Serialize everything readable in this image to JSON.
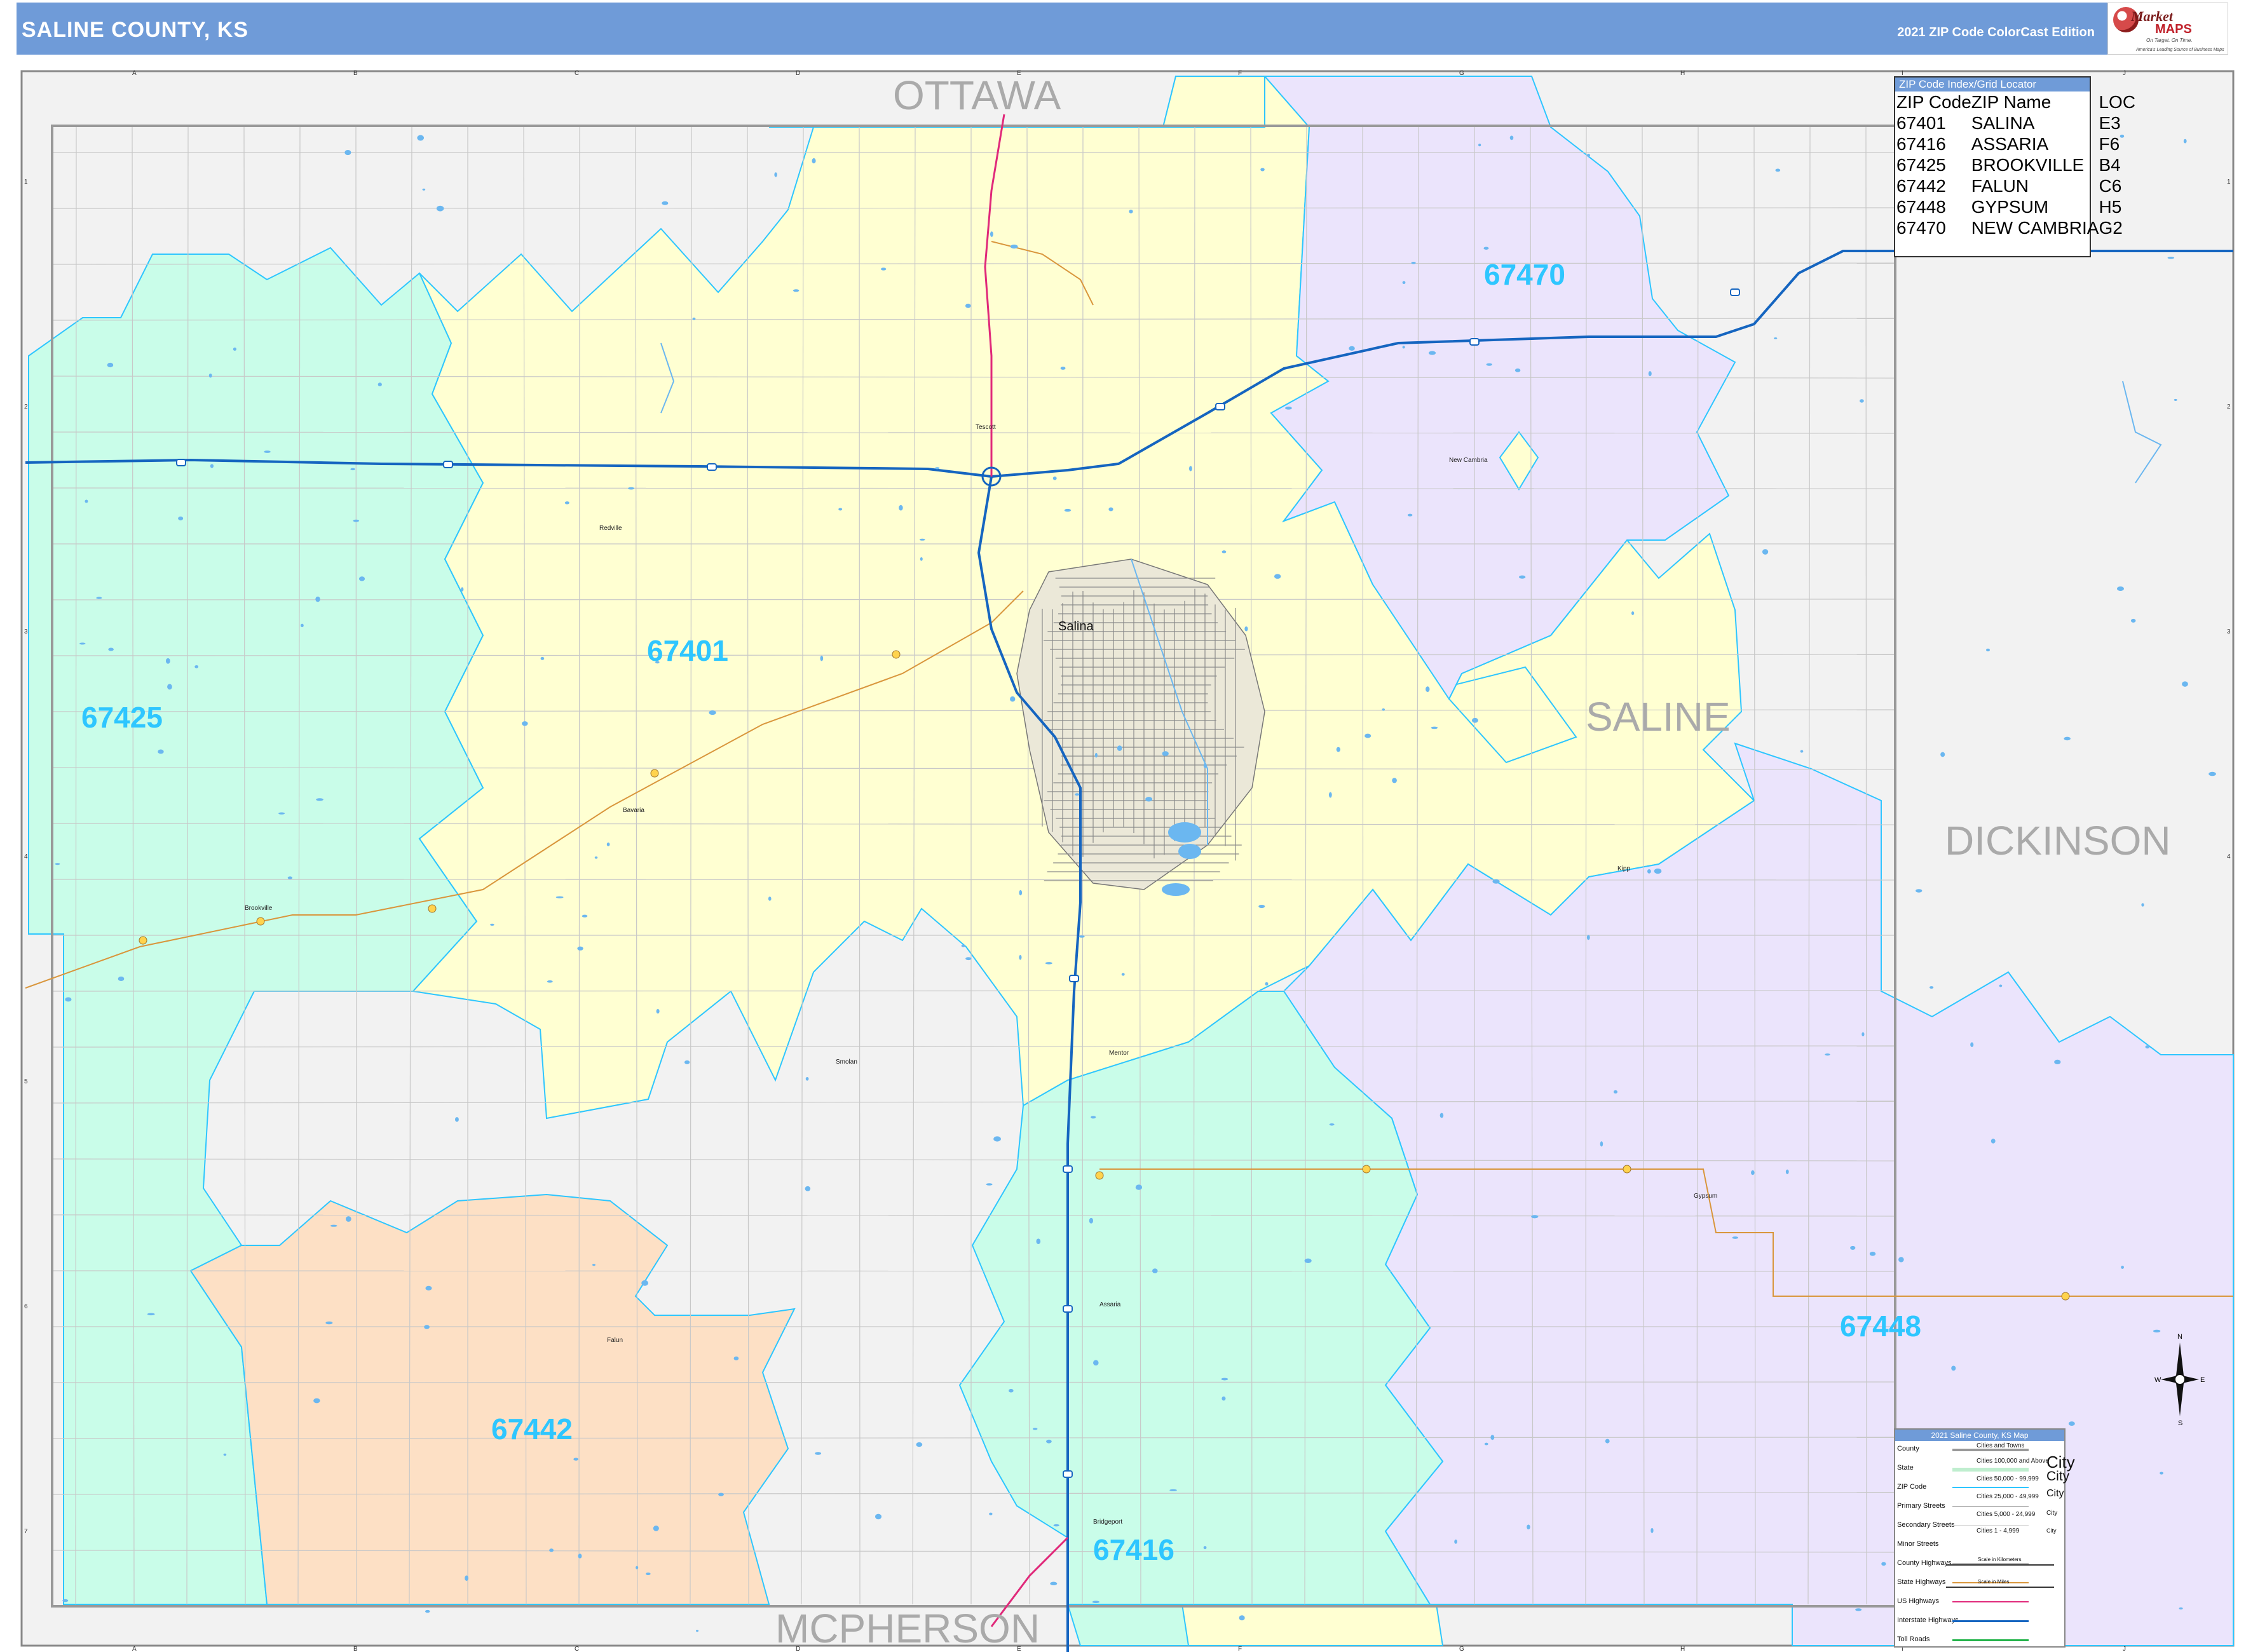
{
  "header": {
    "title": "SALINE COUNTY, KS",
    "edition": "2021 ZIP Code ColorCast Edition",
    "logo": {
      "line1": "Market",
      "line2": "MAPS",
      "tagline1": "On Target. On Time.",
      "tagline2": "America's Leading Source of Business Maps"
    }
  },
  "grid": {
    "columns": [
      "A",
      "B",
      "C",
      "D",
      "E",
      "F",
      "G",
      "H",
      "I",
      "J"
    ],
    "rows": [
      "1",
      "2",
      "3",
      "4",
      "5",
      "6",
      "7"
    ]
  },
  "counties": {
    "ottawa": "OTTAWA",
    "saline": "SALINE",
    "dickinson": "DICKINSON",
    "mcpherson": "MCPHERSON"
  },
  "zips": {
    "z67401": "67401",
    "z67470": "67470",
    "z67425": "67425",
    "z67442": "67442",
    "z67416": "67416",
    "z67448": "67448"
  },
  "towns": {
    "salina": "Salina",
    "tescott": "Tescott",
    "new_cambria": "New Cambria",
    "bavaria": "Bavaria",
    "brookville": "Brookville",
    "kipp": "Kipp",
    "smolan": "Smolan",
    "mentor": "Mentor",
    "gypsum": "Gypsum",
    "assaria": "Assaria",
    "falun": "Falun",
    "bridgeport": "Bridgeport",
    "redville": "Redville"
  },
  "zip_index": {
    "title": "ZIP Code Index/Grid Locator",
    "headers": [
      "ZIP Code",
      "ZIP Name",
      "LOC"
    ],
    "rows": [
      [
        "67401",
        "SALINA",
        "E3"
      ],
      [
        "67416",
        "ASSARIA",
        "F6"
      ],
      [
        "67425",
        "BROOKVILLE",
        "B4"
      ],
      [
        "67442",
        "FALUN",
        "C6"
      ],
      [
        "67448",
        "GYPSUM",
        "H5"
      ],
      [
        "67470",
        "NEW CAMBRIA",
        "G2"
      ]
    ]
  },
  "legend": {
    "title": "2021 Saline County, KS Map",
    "items": [
      "County",
      "State",
      "ZIP Code",
      "Primary Streets",
      "Secondary Streets",
      "Minor Streets",
      "County Highways",
      "State Highways",
      "US Highways",
      "Interstate Highways",
      "Toll Roads"
    ],
    "cities_title": "Cities and Towns",
    "cities": [
      "Cities 100,000 and Above",
      "Cities 50,000 - 99,999",
      "Cities 25,000 - 49,999",
      "Cities 5,000 - 24,999",
      "Cities 1 - 4,999"
    ],
    "city_sample": "City",
    "scale_km": "Scale in Kilometers",
    "scale_mi": "Scale in Miles"
  },
  "compass": {
    "n": "N",
    "s": "S",
    "e": "E",
    "w": "W"
  },
  "colors": {
    "header": "#6f9bd8",
    "zip_67401": "#ffffd2",
    "zip_67470": "#ebe4fc",
    "zip_67425": "#c9fde9",
    "zip_67442": "#fde0c5",
    "zip_67416": "#c9fde9",
    "zip_67448": "#ebe4fc",
    "outside": "#f2f2f2",
    "zip_border": "#2ec6ff",
    "interstate": "#1565c0",
    "us_highway": "#e0297a",
    "state_highway": "#d9963c"
  }
}
